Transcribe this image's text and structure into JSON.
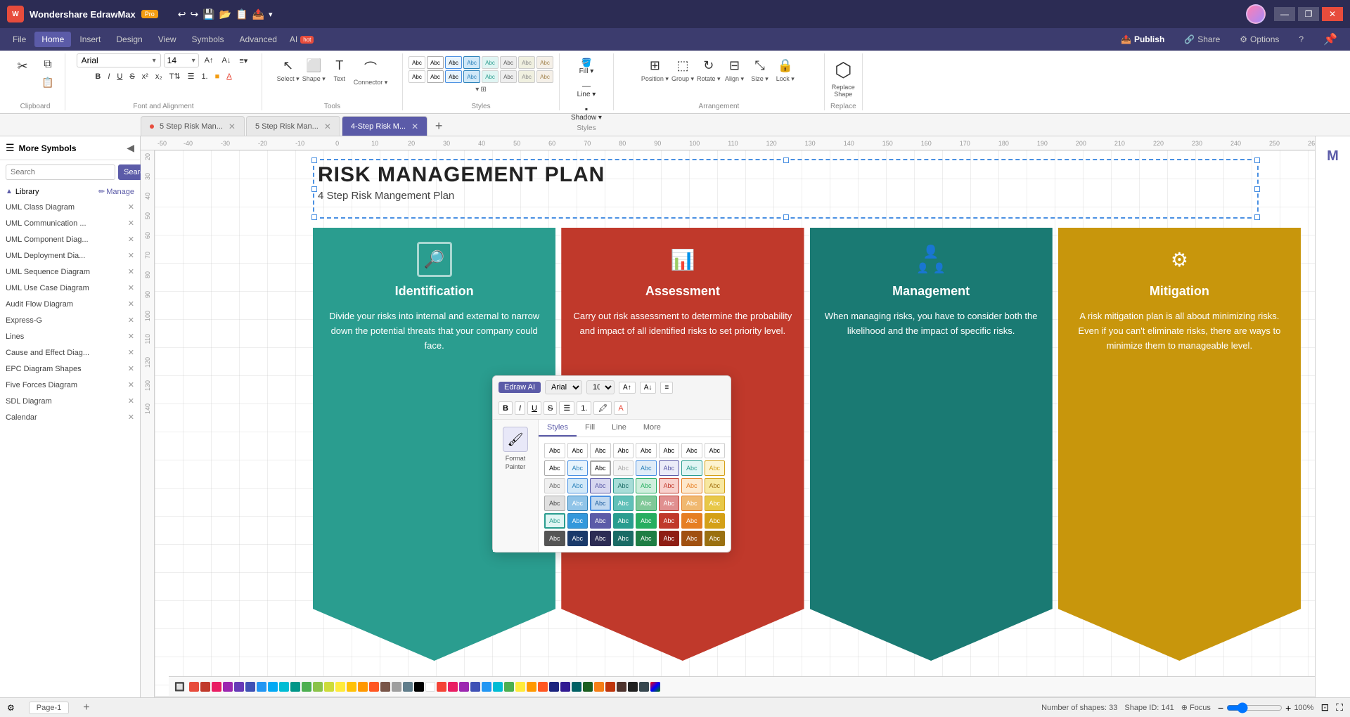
{
  "app": {
    "name": "Wondershare EdrawMax",
    "badge": "Pro",
    "title": "Wondershare EdrawMax Pro"
  },
  "titlebar": {
    "undo": "↩",
    "redo": "↪",
    "save": "💾",
    "open": "📂",
    "template": "📋",
    "share_save": "📤",
    "more": "▾",
    "minimize": "—",
    "restore": "❐",
    "close": "✕"
  },
  "menubar": {
    "items": [
      "File",
      "Home",
      "Insert",
      "Design",
      "View",
      "Symbols",
      "Advanced"
    ],
    "ai_label": "AI",
    "ai_badge": "hot",
    "right": {
      "publish": "Publish",
      "share": "Share",
      "options": "Options",
      "help": "?"
    }
  },
  "ribbon": {
    "clipboard": {
      "label": "Clipboard",
      "cut": "✂",
      "copy": "📋",
      "paste": "📌",
      "paste_special": "📌▾"
    },
    "font": {
      "label": "Font and Alignment",
      "family": "Arial",
      "size": "14",
      "bold": "B",
      "italic": "I",
      "underline": "U",
      "strikethrough": "S",
      "superscript": "x²",
      "subscript": "x₂",
      "text_align": "≡",
      "bullet": "☰",
      "number": "1.",
      "font_color": "A",
      "fill_color": "A"
    },
    "tools": {
      "label": "Tools",
      "select_label": "Select",
      "shape_label": "Shape",
      "text_label": "Text",
      "connector_label": "Connector"
    },
    "styles": {
      "label": "Styles",
      "abc_cells": [
        "Abc",
        "Abc",
        "Abc",
        "Abc",
        "Abc",
        "Abc",
        "Abc",
        "Abc"
      ]
    },
    "fill": {
      "label": "Fill",
      "fill_btn": "Fill",
      "line_btn": "Line",
      "shadow_btn": "Shadow"
    },
    "arrangement": {
      "label": "Arrangement",
      "position": "Position",
      "group": "Group",
      "rotate": "Rotate",
      "align": "Align",
      "size": "Size",
      "lock": "Lock"
    },
    "replace": {
      "label": "Replace",
      "replace_shape": "Replace Shape"
    }
  },
  "tabs": [
    {
      "id": "tab1",
      "label": "5 Step Risk Man...",
      "active": false,
      "modified": true,
      "closable": true
    },
    {
      "id": "tab2",
      "label": "5 Step Risk Man...",
      "active": false,
      "modified": false,
      "closable": true
    },
    {
      "id": "tab3",
      "label": "4-Step Risk M...",
      "active": true,
      "modified": false,
      "closable": true
    }
  ],
  "sidebar": {
    "title": "More Symbols",
    "search_placeholder": "Search",
    "search_btn": "Search",
    "library_label": "Library",
    "manage_label": "Manage",
    "items": [
      "UML Class Diagram",
      "UML Communication ...",
      "UML Component Diag...",
      "UML Deployment Dia...",
      "UML Sequence Diagram",
      "UML Use Case Diagram",
      "Audit Flow Diagram",
      "Express-G",
      "Lines",
      "Cause and Effect Diag...",
      "EPC Diagram Shapes",
      "Five Forces Diagram",
      "SDL Diagram",
      "Calendar"
    ]
  },
  "canvas": {
    "title": "RISK MANAGEMENT PLAN",
    "subtitle": "4 Step Risk Mangement Plan"
  },
  "risk_cards": [
    {
      "id": "identification",
      "title": "Identification",
      "color": "#2a9d8f",
      "icon": "🔍",
      "desc": "Divide your risks into internal and external to narrow down the potential threats that your company could face."
    },
    {
      "id": "assessment",
      "title": "Assessment",
      "color": "#c0392b",
      "icon": "📊",
      "desc": "Carry out risk assessment to determine the probability and impact of all identified risks to set priority level."
    },
    {
      "id": "management",
      "title": "Management",
      "color": "#2a9d8f",
      "icon": "👥",
      "desc": "When managing risks, you have to consider both the likelihood and the impact of specific risks."
    },
    {
      "id": "mitigation",
      "title": "Mitigation",
      "color": "#d4a017",
      "icon": "⚙",
      "desc": "A risk mitigation plan is all about minimizing risks. Even if you can't eliminate risks, there are ways to minimize them to manageable level."
    }
  ],
  "style_picker": {
    "font": "Arial",
    "size": "10",
    "tabs": [
      "Styles",
      "Fill",
      "Line",
      "More"
    ],
    "format_painter": "Format\nPainter",
    "abc_grid": [
      [
        "Abc",
        "Abc",
        "Abc",
        "Abc",
        "Abc",
        "Abc",
        "Abc",
        "Abc"
      ],
      [
        "Abc",
        "Abc",
        "Abc",
        "Abc",
        "Abc",
        "Abc",
        "Abc",
        "Abc"
      ],
      [
        "Abc",
        "Abc",
        "Abc",
        "Abc",
        "Abc",
        "Abc",
        "Abc",
        "Abc"
      ],
      [
        "Abc",
        "Abc",
        "Abc",
        "Abc",
        "Abc",
        "Abc",
        "Abc",
        "Abc"
      ],
      [
        "Abc",
        "Abc",
        "Abc",
        "Abc",
        "Abc",
        "Abc",
        "Abc",
        "Abc"
      ],
      [
        "Abc",
        "Abc",
        "Abc",
        "Abc",
        "Abc",
        "Abc",
        "Abc",
        "Abc"
      ]
    ]
  },
  "statusbar": {
    "shapes": "Number of shapes: 33",
    "shape_id": "Shape ID: 141",
    "focus": "Focus",
    "zoom": "100%",
    "page": "Page-1"
  },
  "colors": [
    "#e74c3c",
    "#c0392b",
    "#e91e63",
    "#9c27b0",
    "#673ab7",
    "#3f51b5",
    "#2196f3",
    "#03a9f4",
    "#00bcd4",
    "#009688",
    "#4caf50",
    "#8bc34a",
    "#cddc39",
    "#ffeb3b",
    "#ffc107",
    "#ff9800",
    "#ff5722",
    "#795548",
    "#9e9e9e",
    "#607d8b",
    "#000000",
    "#ffffff",
    "#f44336",
    "#e91e63",
    "#9c27b0",
    "#3f51b5",
    "#2196f3",
    "#00bcd4",
    "#4caf50",
    "#ffeb3b",
    "#ff9800",
    "#ff5722"
  ],
  "page_label": "Page-1",
  "add_page": "+"
}
